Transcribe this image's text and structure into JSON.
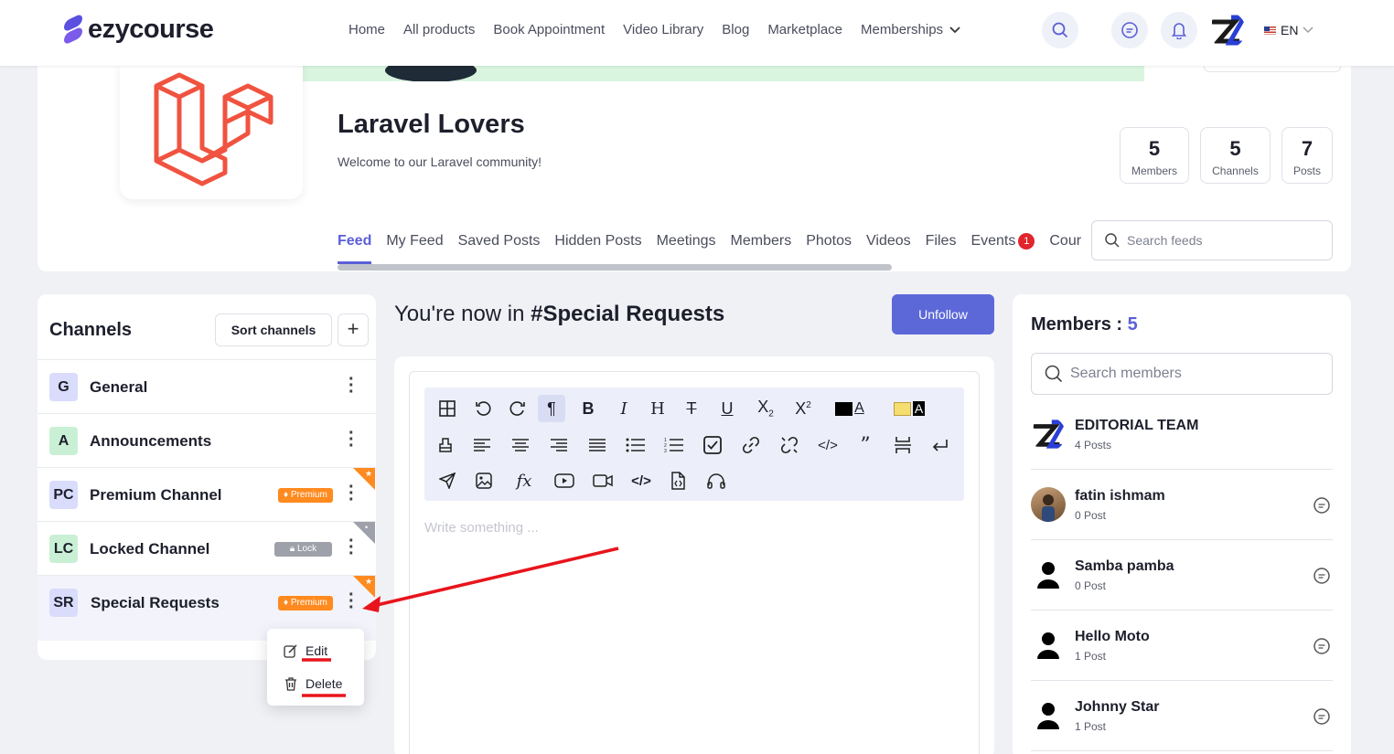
{
  "header": {
    "brand": "ezycourse",
    "nav": [
      "Home",
      "All products",
      "Book Appointment",
      "Video Library",
      "Blog",
      "Marketplace",
      "Memberships"
    ],
    "lang": "EN"
  },
  "group": {
    "title": "Laravel Lovers",
    "description": "Welcome to our Laravel community!",
    "stats": [
      {
        "num": "5",
        "label": "Members"
      },
      {
        "num": "5",
        "label": "Channels"
      },
      {
        "num": "7",
        "label": "Posts"
      }
    ],
    "tabs": [
      "Feed",
      "My Feed",
      "Saved Posts",
      "Hidden Posts",
      "Meetings",
      "Members",
      "Photos",
      "Videos",
      "Files",
      "Events",
      "Cour"
    ],
    "events_badge": "1",
    "search_placeholder": "Search feeds"
  },
  "channels": {
    "title": "Channels",
    "sort_label": "Sort channels",
    "add_label": "+",
    "items": [
      {
        "initials": "G",
        "name": "General",
        "color": "#d9dcfb"
      },
      {
        "initials": "A",
        "name": "Announcements",
        "color": "#c9f0d5"
      },
      {
        "initials": "PC",
        "name": "Premium Channel",
        "color": "#d9dcfb",
        "badge": "Premium"
      },
      {
        "initials": "LC",
        "name": "Locked Channel",
        "color": "#c9f0d5",
        "badge": "Lock"
      },
      {
        "initials": "SR",
        "name": "Special Requests",
        "color": "#d9dcfb",
        "badge": "Premium"
      }
    ],
    "menu": {
      "edit": "Edit",
      "delete": "Delete"
    }
  },
  "feed": {
    "prefix": "You're now in",
    "channel": "#Special Requests",
    "unfollow": "Unfollow",
    "placeholder": "Write something ..."
  },
  "members": {
    "title": "Members : ",
    "count": "5",
    "search_placeholder": "Search members",
    "list": [
      {
        "name": "EDITORIAL TEAM",
        "posts": "4 Posts"
      },
      {
        "name": "fatin ishmam",
        "posts": "0 Post"
      },
      {
        "name": "Samba pamba",
        "posts": "0 Post"
      },
      {
        "name": "Hello Moto",
        "posts": "1 Post"
      },
      {
        "name": "Johnny Star",
        "posts": "1 Post"
      }
    ]
  },
  "colors": {
    "accent": "#5b5fd6",
    "unfollow": "#5c68d8",
    "premium": "#ff8a1f",
    "annotation": "#e8141c"
  }
}
